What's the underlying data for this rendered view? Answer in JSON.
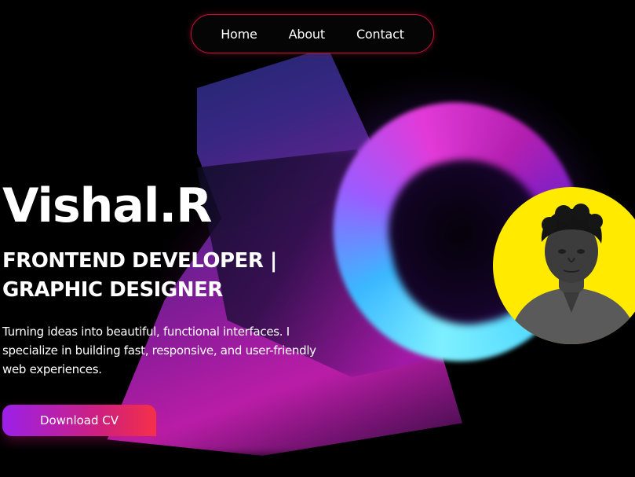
{
  "nav": {
    "links": [
      "Home",
      "About",
      "Contact"
    ]
  },
  "hero": {
    "name": "Vishal.R",
    "role": "FRONTEND DEVELOPER | GRAPHIC DESIGNER",
    "description": "Turning ideas into beautiful, functional interfaces. I specialize in building fast, responsive, and user-friendly web experiences.",
    "cta_label": "Download CV"
  },
  "colors": {
    "background": "#000000",
    "nav_border": "#c3123a",
    "cta_gradient_start": "#9b20e8",
    "cta_gradient_end": "#f43049",
    "avatar_background": "#ffea00",
    "text": "#ffffff"
  },
  "icons": {
    "profile_photo": "avatar-photo"
  }
}
